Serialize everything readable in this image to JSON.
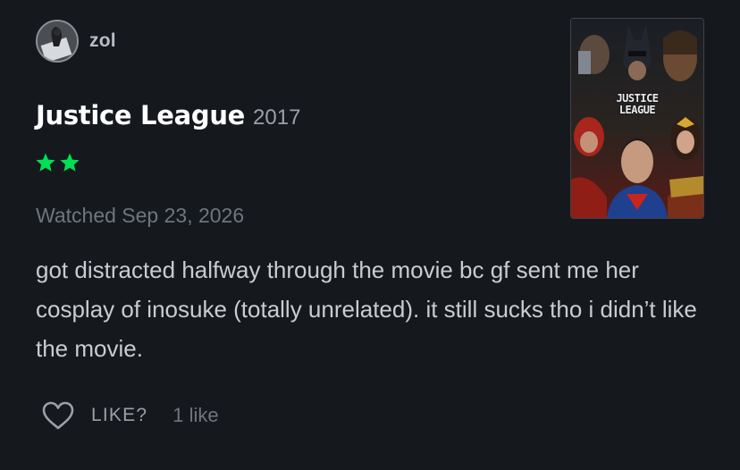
{
  "review": {
    "author": {
      "name": "zol"
    },
    "film": {
      "title": "Justice League",
      "year": "2017"
    },
    "rating": {
      "stars": 2,
      "max_stars": 5,
      "star_color": "#00e054"
    },
    "watched_date": "Watched Sep 23, 2026",
    "text": "got distracted halfway through the movie bc gf sent me her cosplay of inosuke (totally unrelated). it still sucks tho i didn’t like the movie.",
    "like": {
      "label": "LIKE?",
      "count": "1 like",
      "icon": "heart-outline-icon"
    },
    "poster": {
      "lettering_line1": "JUSTICE",
      "lettering_line2": "LEAGUE"
    }
  },
  "colors": {
    "background": "#15181d",
    "title": "#ffffff",
    "muted": "#6f757c",
    "body": "#c9ccd0"
  }
}
